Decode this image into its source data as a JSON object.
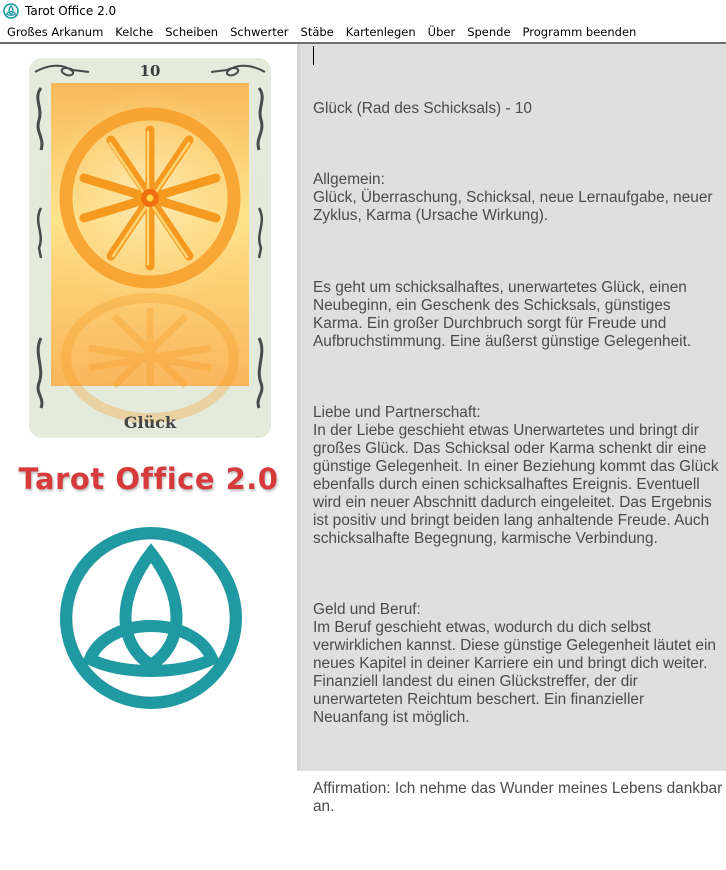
{
  "window": {
    "title": "Tarot Office 2.0",
    "icon": "triquetra-icon"
  },
  "menu": {
    "items": [
      {
        "label": "Großes Arkanum"
      },
      {
        "label": "Kelche"
      },
      {
        "label": "Scheiben"
      },
      {
        "label": "Schwerter"
      },
      {
        "label": "Stäbe"
      },
      {
        "label": "Kartenlegen"
      },
      {
        "label": "Über"
      },
      {
        "label": "Spende"
      },
      {
        "label": "Programm beenden"
      }
    ]
  },
  "card": {
    "number": "10",
    "name": "Glück",
    "image": "wheel-of-fortune-icon",
    "colors": {
      "frame": "#e4eadc",
      "art": "#fbbf5d",
      "wheel": "#f59a1e"
    }
  },
  "brand": {
    "label": "Tarot Office 2.0",
    "color": "#d63a3a",
    "logo": "triquetra-icon",
    "logo_color": "#1f9aa3"
  },
  "reading": {
    "title": "Glück (Rad des Schicksals) - 10",
    "sections": [
      {
        "heading": "Allgemein:",
        "text": "Glück, Überraschung, Schicksal, neue Lernaufgabe, neuer Zyklus, Karma (Ursache Wirkung)."
      },
      {
        "heading": "",
        "text": "Es geht um schicksalhaftes, unerwartetes Glück, einen Neubeginn, ein Geschenk des Schicksals, günstiges Karma. Ein großer Durchbruch sorgt für Freude und Aufbruchstimmung. Eine äußerst günstige Gelegenheit."
      },
      {
        "heading": "Liebe und Partnerschaft:",
        "text": "In der Liebe geschieht etwas Unerwartetes und bringt dir großes Glück. Das Schicksal oder Karma schenkt dir eine günstige Gelegenheit. In einer Beziehung kommt das Glück ebenfalls durch einen schicksalhaftes Ereignis. Eventuell wird ein neuer Abschnitt dadurch eingeleitet. Das Ergebnis ist positiv und bringt beiden lang anhaltende Freude. Auch schicksalhafte Begegnung, karmische Verbindung."
      },
      {
        "heading": "Geld und Beruf:",
        "text": "Im Beruf geschieht etwas, wodurch du dich selbst verwirklichen kannst. Diese günstige Gelegenheit läutet ein neues Kapitel in deiner Karriere ein und bringt dich weiter. Finanziell landest du einen Glückstreffer, der dir unerwarteten Reichtum beschert. Ein finanzieller Neuanfang ist möglich."
      },
      {
        "heading": "",
        "text": "Affirmation: Ich nehme das Wunder meines Lebens dankbar an."
      }
    ]
  }
}
